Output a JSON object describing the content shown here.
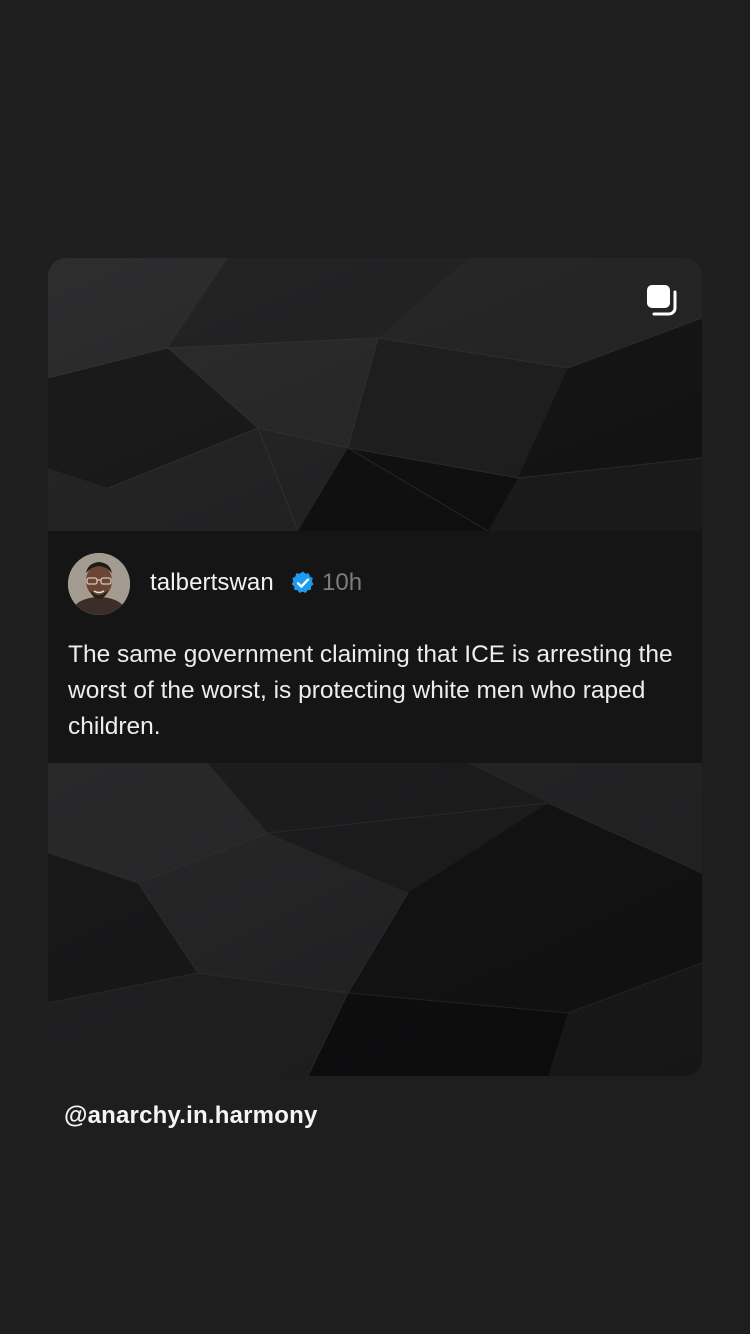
{
  "post": {
    "username": "talbertswan",
    "time": "10h",
    "text": "The same government claiming that ICE is arresting the worst of the worst, is protecting white men who raped children.",
    "verified": true
  },
  "story": {
    "mention": "@anarchy.in.harmony"
  },
  "icons": {
    "multi_post": "carousel-icon",
    "verified": "verified-badge-icon",
    "avatar": "profile-avatar"
  },
  "colors": {
    "background": "#1e1e1f",
    "verified_blue": "#1d9bf0",
    "text_primary": "#ededed",
    "text_secondary": "#7c7c7c"
  }
}
